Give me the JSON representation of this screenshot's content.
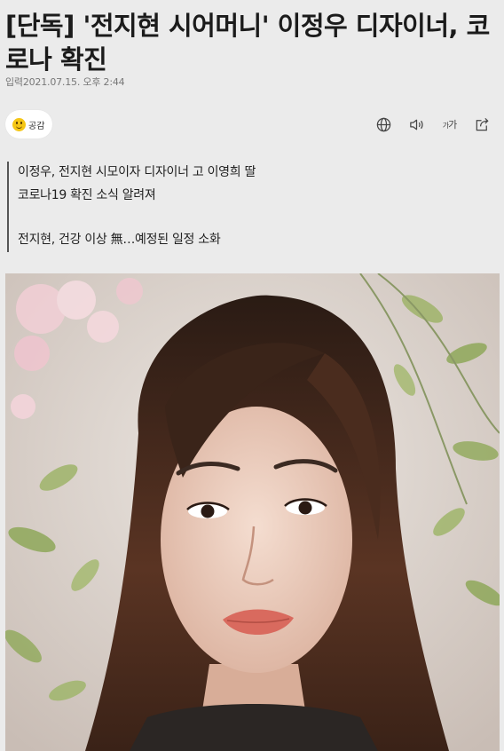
{
  "article": {
    "headline": "[단독] '전지현 시어머니' 이정우 디자이너, 코로나 확진",
    "date": "입력2021.07.15. 오후 2:44",
    "empathy_label": "공감",
    "summary": [
      "이정우, 전지현 시모이자 디자이너 고 이영희 딸",
      "코로나19 확진 소식 알려져",
      "",
      "전지현, 건강 이상 無…예정된 일정 소화"
    ]
  },
  "toolbar": {
    "icons": [
      "globe-icon",
      "speaker-icon",
      "font-size-icon",
      "share-icon"
    ],
    "font_size_label": "가가"
  },
  "colors": {
    "background": "#ebebeb",
    "emoji": "#f5c614",
    "summary_bar": "#555555"
  }
}
